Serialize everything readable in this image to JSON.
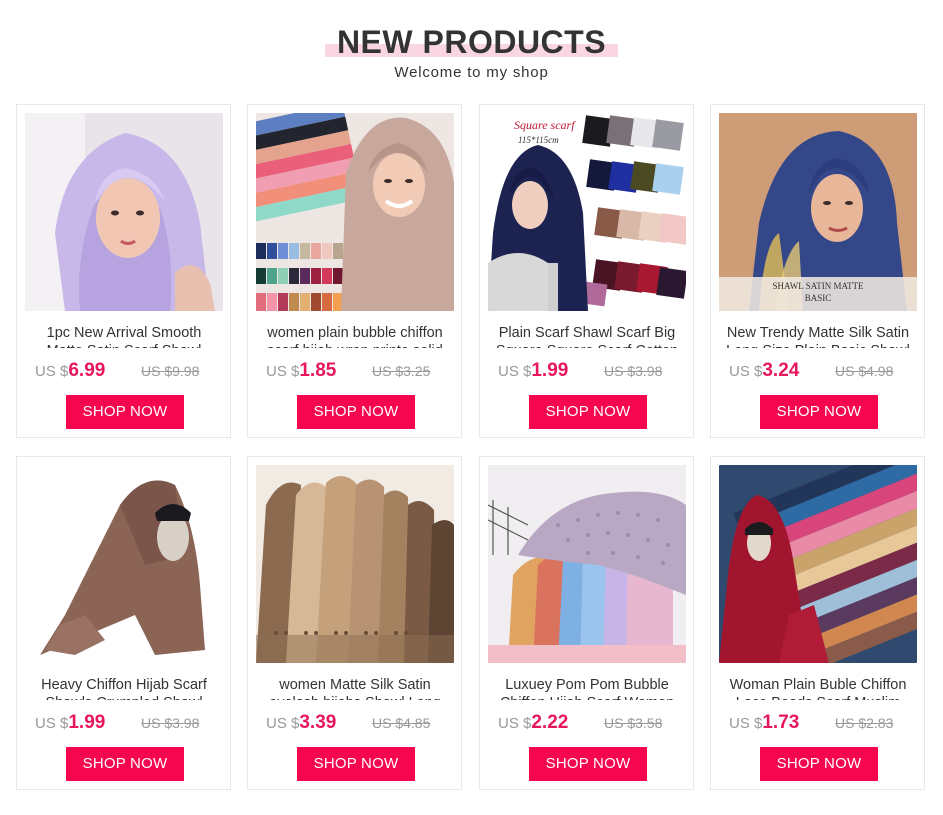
{
  "header": {
    "title": "NEW PRODUCTS",
    "subtitle": "Welcome to my shop"
  },
  "colors": {
    "accent": "#f5064f",
    "price": "#e8175d",
    "title_underline": "#f9d6e1",
    "muted": "#999999"
  },
  "products": [
    {
      "name": "1pc New Arrival Smooth",
      "name2": "Matte Satin Scarf Shawl",
      "currency": "US $",
      "price": "6.99",
      "old_price": "US $9.98",
      "button": "SHOP NOW"
    },
    {
      "name": "women plain bubble chiffon",
      "name2": "scarf hijab wrap printe solid",
      "currency": "US $",
      "price": "1.85",
      "old_price": "US $3.25",
      "button": "SHOP NOW"
    },
    {
      "name": "Plain Scarf Shawl Scarf Big",
      "name2": "Square Square Scarf Cotton",
      "currency": "US $",
      "price": "1.99",
      "old_price": "US $3.98",
      "button": "SHOP NOW"
    },
    {
      "name": "New Trendy Matte Silk Satin",
      "name2": "Long Size Plain Basic Shawl",
      "currency": "US $",
      "price": "3.24",
      "old_price": "US $4.98",
      "button": "SHOP NOW"
    },
    {
      "name": "Heavy Chiffon Hijab Scarf",
      "name2": "Shawls Crumpled Shawl",
      "currency": "US $",
      "price": "1.99",
      "old_price": "US $3.98",
      "button": "SHOP NOW"
    },
    {
      "name": "women Matte Silk Satin",
      "name2": "eyelash hijabs Shawl Long",
      "currency": "US $",
      "price": "3.39",
      "old_price": "US $4.85",
      "button": "SHOP NOW"
    },
    {
      "name": "Luxuey Pom Pom Bubble",
      "name2": "Chiffon Hijab Scarf Women",
      "currency": "US $",
      "price": "2.22",
      "old_price": "US $3.58",
      "button": "SHOP NOW"
    },
    {
      "name": "Woman Plain Buble Chiffon",
      "name2": "Lace Beads Scarf Muslim",
      "currency": "US $",
      "price": "1.73",
      "old_price": "US $2.83",
      "button": "SHOP NOW"
    }
  ],
  "image_labels": {
    "p3_title": "Square scarf",
    "p3_size": "115*115cm",
    "p4_caption": "SHAWL SATIN MATTE",
    "p4_caption2": "BASIC"
  }
}
